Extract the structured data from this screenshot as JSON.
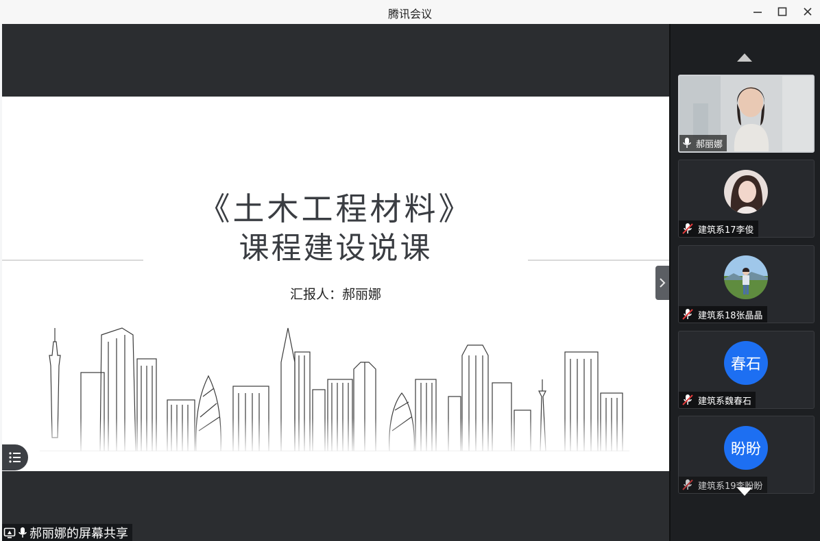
{
  "window": {
    "title": "腾讯会议"
  },
  "slide": {
    "title_line1": "《土木工程材料》",
    "title_line2": "课程建设说课",
    "reporter": "汇报人：郝丽娜"
  },
  "share_label": "郝丽娜的屏幕共享",
  "participants": [
    {
      "name": "郝丽娜",
      "type": "video",
      "mic": "on"
    },
    {
      "name": "建筑系17李俊",
      "type": "photo",
      "mic": "muted"
    },
    {
      "name": "建筑系18张晶晶",
      "type": "photo",
      "mic": "muted"
    },
    {
      "name": "建筑系魏春石",
      "type": "initials",
      "initials": "春石",
      "mic": "muted"
    },
    {
      "name": "建筑系19李盼盼",
      "type": "initials",
      "initials": "盼盼",
      "mic": "muted"
    }
  ],
  "colors": {
    "stage_bg": "#2b2d30",
    "panel_bg": "#1d1f22",
    "avatar_blue": "#1d6ff2",
    "muted_red": "#e23b3b"
  },
  "icons": {
    "minimize": "minimize-icon",
    "maximize": "maximize-icon",
    "close": "close-icon",
    "list": "list-icon",
    "chevron_right": "chevron-right-icon",
    "scroll_up": "triangle-up-icon",
    "scroll_down": "triangle-down-icon",
    "mic": "microphone-icon",
    "mic_muted": "microphone-muted-icon",
    "screen_share": "screen-share-icon"
  }
}
